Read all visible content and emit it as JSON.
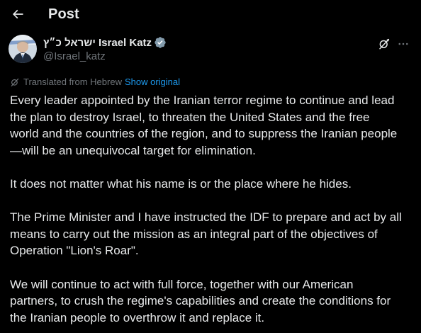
{
  "header": {
    "title": "Post"
  },
  "author": {
    "display_name": "ישראל כ״ץ Israel Katz",
    "handle": "@Israel_katz",
    "verified": true,
    "verified_color": "#829aab"
  },
  "translation": {
    "label": "Translated from Hebrew",
    "show_original": "Show original"
  },
  "post": {
    "paragraphs": [
      {
        "lines": [
          "Every leader appointed by the Iranian terror regime to continue and lead",
          "the plan to destroy Israel, to threaten the United States and the free",
          "world and the countries of the region, and to suppress the Iranian people",
          "—will be an unequivocal target for elimination."
        ]
      },
      {
        "lines": [
          "It does not matter what his name is or the place where he hides."
        ]
      },
      {
        "lines": [
          "The Prime Minister and I have instructed the IDF to prepare and act by all",
          "means to carry out the mission as an integral part of the objectives of",
          "Operation \"Lion's Roar\"."
        ]
      },
      {
        "lines": [
          "We will continue to act with full force, together with our American",
          "partners, to crush the regime's capabilities and create the conditions for",
          "the Iranian people to overthrow it and replace it."
        ]
      }
    ]
  },
  "colors": {
    "background": "#000000",
    "text": "#e7e9ea",
    "secondary": "#71767b",
    "link": "#1d9bf0"
  },
  "icons": {
    "back": "arrow-left-icon",
    "verified": "verified-badge-icon",
    "grok": "grok-icon",
    "more": "more-horizontal-icon",
    "translate": "translate-icon"
  }
}
